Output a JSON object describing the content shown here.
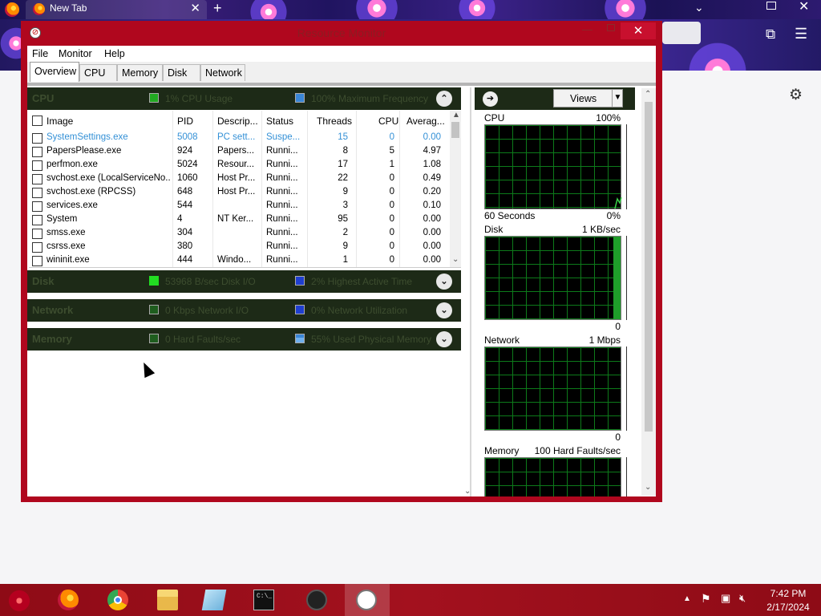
{
  "browser": {
    "tab_title": "New Tab",
    "tab_close": "✕",
    "new_tab": "+"
  },
  "window": {
    "title": "Resource Monitor",
    "close_glyph": "✕"
  },
  "menubar": [
    "File",
    "Monitor",
    "Help"
  ],
  "tabs": [
    "Overview",
    "CPU",
    "Memory",
    "Disk",
    "Network"
  ],
  "cpu_section": {
    "title": "CPU",
    "stat1": "1% CPU Usage",
    "stat2": "100% Maximum Frequency",
    "stat1_color": "#22aa22",
    "stat2_color": "#3a86d6",
    "columns": [
      "Image",
      "PID",
      "Descrip...",
      "Status",
      "Threads",
      "CPU",
      "Averag..."
    ],
    "rows": [
      {
        "image": "SystemSettings.exe",
        "pid": "5008",
        "desc": "PC sett...",
        "status": "Suspe...",
        "threads": "15",
        "cpu": "0",
        "avg": "0.00"
      },
      {
        "image": "PapersPlease.exe",
        "pid": "924",
        "desc": "Papers...",
        "status": "Runni...",
        "threads": "8",
        "cpu": "5",
        "avg": "4.97"
      },
      {
        "image": "perfmon.exe",
        "pid": "5024",
        "desc": "Resour...",
        "status": "Runni...",
        "threads": "17",
        "cpu": "1",
        "avg": "1.08"
      },
      {
        "image": "svchost.exe (LocalServiceNo...",
        "pid": "1060",
        "desc": "Host Pr...",
        "status": "Runni...",
        "threads": "22",
        "cpu": "0",
        "avg": "0.49"
      },
      {
        "image": "svchost.exe (RPCSS)",
        "pid": "648",
        "desc": "Host Pr...",
        "status": "Runni...",
        "threads": "9",
        "cpu": "0",
        "avg": "0.20"
      },
      {
        "image": "services.exe",
        "pid": "544",
        "desc": "",
        "status": "Runni...",
        "threads": "3",
        "cpu": "0",
        "avg": "0.10"
      },
      {
        "image": "System",
        "pid": "4",
        "desc": "NT Ker...",
        "status": "Runni...",
        "threads": "95",
        "cpu": "0",
        "avg": "0.00"
      },
      {
        "image": "smss.exe",
        "pid": "304",
        "desc": "",
        "status": "Runni...",
        "threads": "2",
        "cpu": "0",
        "avg": "0.00"
      },
      {
        "image": "csrss.exe",
        "pid": "380",
        "desc": "",
        "status": "Runni...",
        "threads": "9",
        "cpu": "0",
        "avg": "0.00"
      },
      {
        "image": "wininit.exe",
        "pid": "444",
        "desc": "Windo...",
        "status": "Runni...",
        "threads": "1",
        "cpu": "0",
        "avg": "0.00"
      }
    ]
  },
  "disk_section": {
    "title": "Disk",
    "stat1": "53968 B/sec Disk I/O",
    "stat2": "2% Highest Active Time",
    "stat1_color": "#22dd22",
    "stat2_color": "#1f3fd0"
  },
  "network_section": {
    "title": "Network",
    "stat1": "0 Kbps Network I/O",
    "stat2": "0% Network Utilization",
    "stat1_color": "#22aa22",
    "stat2_color": "#1f3fd0"
  },
  "memory_section": {
    "title": "Memory",
    "stat1": "0 Hard Faults/sec",
    "stat2": "55% Used Physical Memory",
    "stat1_color": "#22aa22",
    "stat2_color": "#3a86d6"
  },
  "right_pane": {
    "views_label": "Views",
    "cpu": {
      "label": "CPU",
      "max": "100%",
      "footer_left": "60 Seconds",
      "footer_right": "0%"
    },
    "disk": {
      "label": "Disk",
      "max": "1 KB/sec",
      "footer_right": "0"
    },
    "network": {
      "label": "Network",
      "max": "1 Mbps",
      "footer_right": "0"
    },
    "memory": {
      "label": "Memory",
      "max": "100 Hard Faults/sec"
    }
  },
  "taskbar": {
    "clock_time": "7:42 PM",
    "clock_date": "2/17/2024",
    "apps": [
      "firefox-icon",
      "chrome-icon",
      "file-explorer-icon",
      "notepad-icon",
      "command-prompt-icon",
      "papers-please-icon",
      "resource-monitor-icon"
    ]
  }
}
